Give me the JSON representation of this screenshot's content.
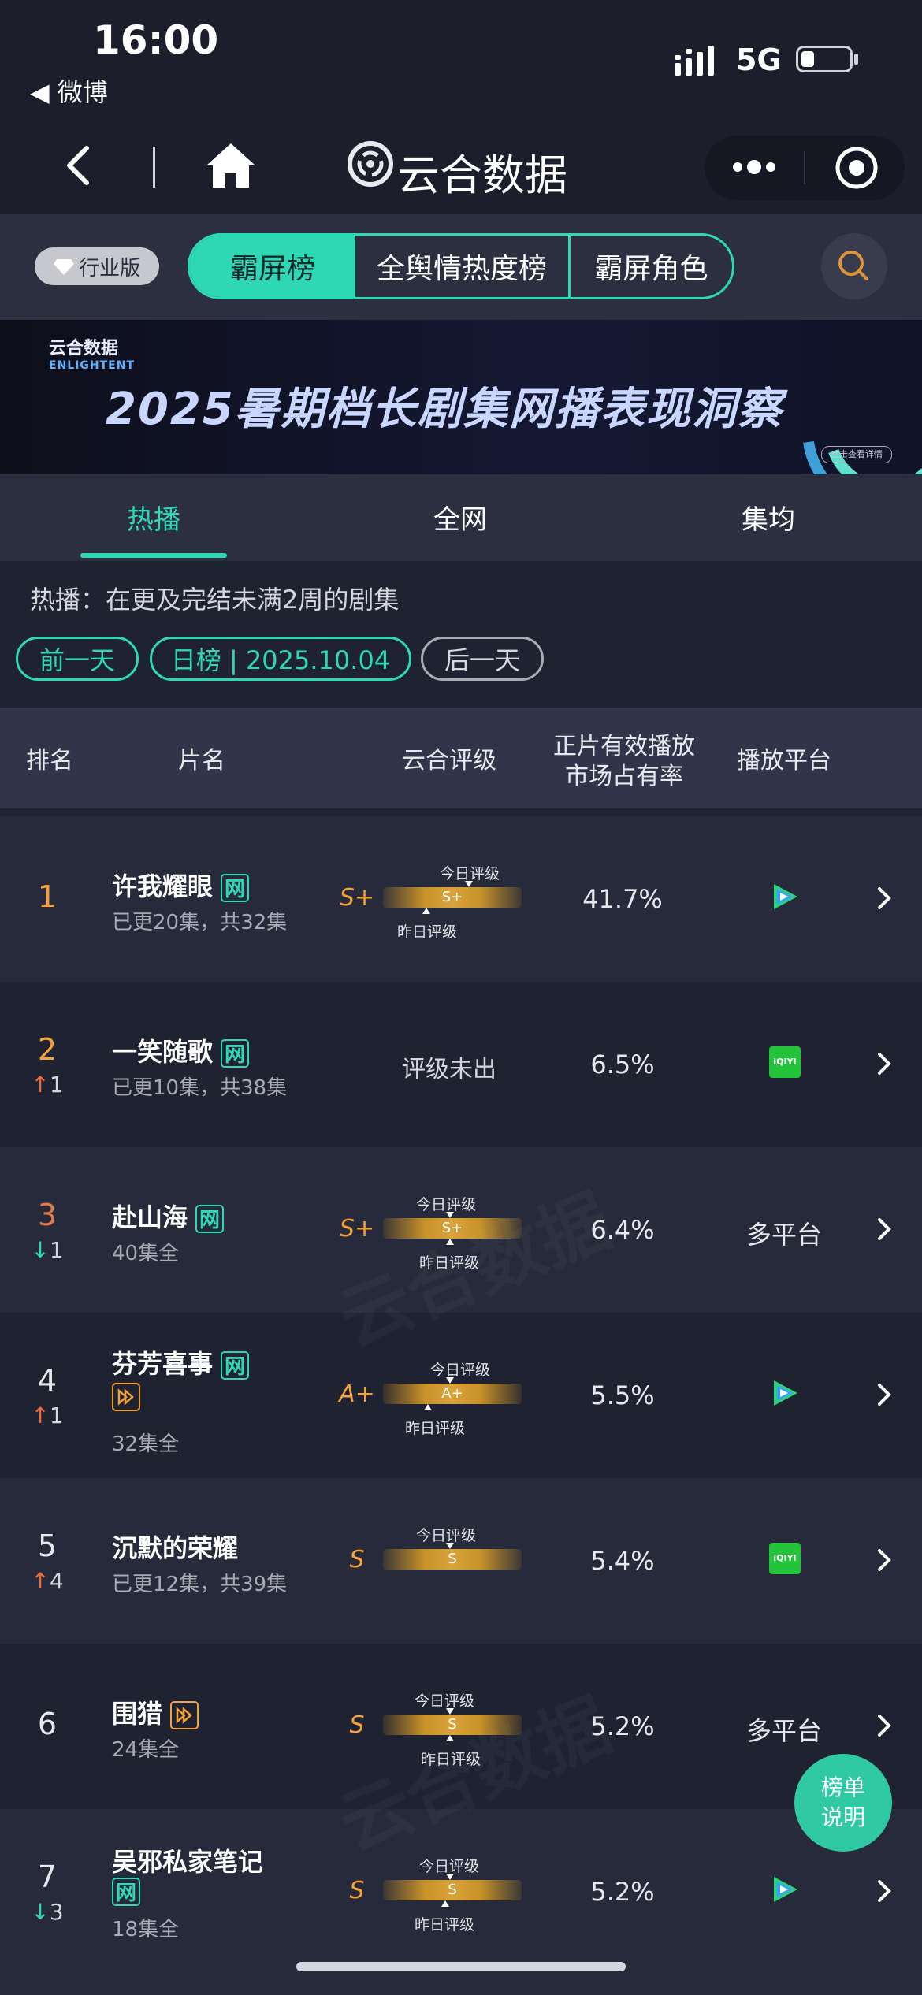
{
  "status_bar": {
    "time": "16:00",
    "back_app": "◀ 微博",
    "network": "5G"
  },
  "nav": {
    "brand": "云合数据"
  },
  "tabbar": {
    "industry": "行业版",
    "tabs": [
      "霸屏榜",
      "全舆情热度榜",
      "霸屏角色"
    ]
  },
  "banner": {
    "logo_cn": "云合数据",
    "logo_en": "ENLIGHTENT",
    "title": "2025暑期档长剧集网播表现洞察",
    "button": "点击查看详情"
  },
  "category_tabs": [
    "热播",
    "全网",
    "集均"
  ],
  "info": {
    "desc": "热播：在更及完结未满2周的剧集",
    "prev": "前一天",
    "date": "日榜 | 2025.10.04",
    "next": "后一天"
  },
  "table_header": {
    "rank": "排名",
    "name": "片名",
    "rating": "云合评级",
    "share_line1": "正片有效播放",
    "share_line2": "市场占有率",
    "platform": "播放平台"
  },
  "labels": {
    "today": "今日评级",
    "yesterday": "昨日评级",
    "net_badge": "网"
  },
  "rows": [
    {
      "rank": "1",
      "change": "",
      "dir": "",
      "title": "许我耀眼",
      "sub": "已更20集，共32集",
      "grade": "S+",
      "bar": "S+",
      "share": "41.7%",
      "platform": "",
      "platform_icon": "tencent-video-icon"
    },
    {
      "rank": "2",
      "change": "1",
      "dir": "up",
      "title": "一笑随歌",
      "sub": "已更10集，共38集",
      "grade": "",
      "bar": "",
      "pending": "评级未出",
      "share": "6.5%",
      "platform": "",
      "platform_icon": "iqiyi-icon",
      "iqiyi": "iQIYI"
    },
    {
      "rank": "3",
      "change": "1",
      "dir": "down",
      "title": "赴山海",
      "sub": "40集全",
      "grade": "S+",
      "bar": "S+",
      "share": "6.4%",
      "platform": "多平台",
      "platform_icon": ""
    },
    {
      "rank": "4",
      "change": "1",
      "dir": "up",
      "title": "芬芳喜事",
      "sub": "32集全",
      "grade": "A+",
      "bar": "A+",
      "share": "5.5%",
      "platform": "",
      "platform_icon": "tencent-video-icon"
    },
    {
      "rank": "5",
      "change": "4",
      "dir": "up",
      "title": "沉默的荣耀",
      "sub": "已更12集，共39集",
      "grade": "S",
      "bar": "S",
      "share": "5.4%",
      "platform": "",
      "platform_icon": "iqiyi-icon",
      "iqiyi": "iQIYI"
    },
    {
      "rank": "6",
      "change": "",
      "dir": "",
      "title": "围猎",
      "sub": "24集全",
      "grade": "S",
      "bar": "S",
      "share": "5.2%",
      "platform": "多平台",
      "platform_icon": ""
    },
    {
      "rank": "7",
      "change": "3",
      "dir": "down",
      "title": "吴邪私家笔记",
      "sub": "18集全",
      "grade": "S",
      "bar": "S",
      "share": "5.2%",
      "platform": "",
      "platform_icon": "tencent-video-icon"
    }
  ],
  "explain_button": [
    "榜单",
    "说明"
  ],
  "watermark": "云合数据"
}
